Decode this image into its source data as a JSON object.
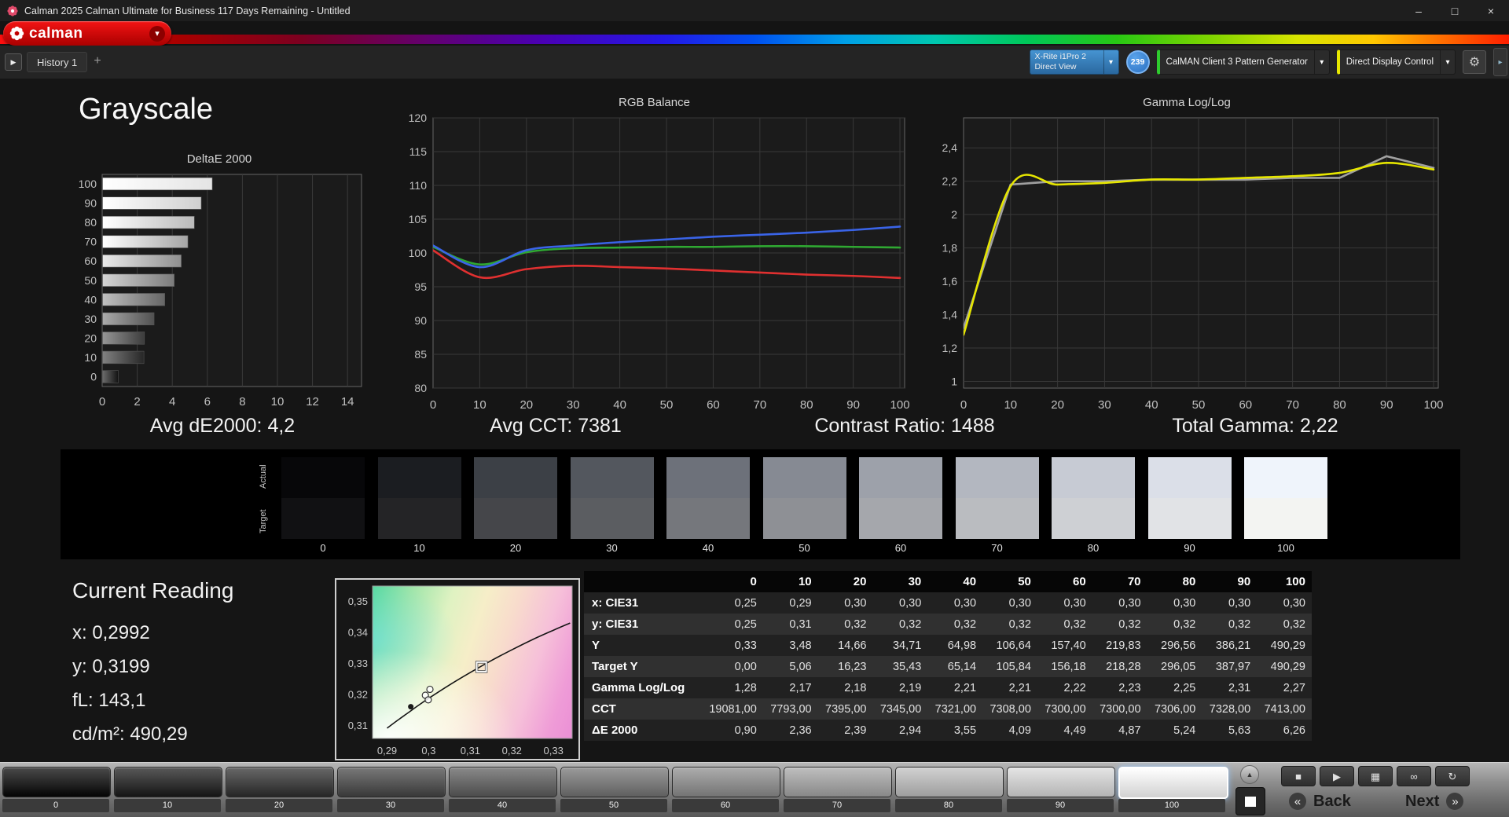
{
  "window": {
    "title": "Calman 2025 Calman Ultimate for Business 117 Days Remaining  - Untitled",
    "minimize": "–",
    "maximize": "□",
    "close": "×"
  },
  "brand": {
    "name": "calman"
  },
  "toolbar": {
    "collapse_glyph": "▶",
    "history_tab": "History 1",
    "add_tab": "+",
    "meter_line1": "X-Rite i1Pro 2",
    "meter_line2": "Direct View",
    "meter_badge": "239",
    "pattern_generator": "CalMAN Client 3 Pattern Generator",
    "display_control": "Direct Display Control",
    "dropdown_arrow": "▾",
    "gear_glyph": "⚙",
    "side_handle_glyph": "▸"
  },
  "page": {
    "title": "Grayscale"
  },
  "stats": [
    "Avg dE2000: 4,2",
    "Avg CCT: 7381",
    "Contrast Ratio: 1488",
    "Total Gamma: 2,22"
  ],
  "current_reading": {
    "title": "Current Reading",
    "lines": [
      "x: 0,2992",
      "y: 0,3199",
      "fL: 143,1",
      "cd/m²: 490,29"
    ]
  },
  "swatches": {
    "actual_label": "Actual",
    "target_label": "Target",
    "items": [
      {
        "label": "0",
        "actual": "#070709",
        "target": "#111113"
      },
      {
        "label": "10",
        "actual": "#1b1d21",
        "target": "#242426"
      },
      {
        "label": "20",
        "actual": "#3c4046",
        "target": "#45464a"
      },
      {
        "label": "30",
        "actual": "#53575e",
        "target": "#5b5d61"
      },
      {
        "label": "40",
        "actual": "#6d717a",
        "target": "#75777c"
      },
      {
        "label": "50",
        "actual": "#868a93",
        "target": "#8e9095"
      },
      {
        "label": "60",
        "actual": "#9da1aa",
        "target": "#a5a7ac"
      },
      {
        "label": "70",
        "actual": "#b3b7c0",
        "target": "#babcc0"
      },
      {
        "label": "80",
        "actual": "#c7cbd4",
        "target": "#ced0d4"
      },
      {
        "label": "90",
        "actual": "#dbdfe8",
        "target": "#e1e3e6"
      },
      {
        "label": "100",
        "actual": "#eff4fb",
        "target": "#f3f4f2"
      }
    ]
  },
  "table": {
    "columns": [
      "0",
      "10",
      "20",
      "30",
      "40",
      "50",
      "60",
      "70",
      "80",
      "90",
      "100"
    ],
    "rows": [
      {
        "label": "x: CIE31",
        "values": [
          "0,25",
          "0,29",
          "0,30",
          "0,30",
          "0,30",
          "0,30",
          "0,30",
          "0,30",
          "0,30",
          "0,30",
          "0,30"
        ]
      },
      {
        "label": "y: CIE31",
        "values": [
          "0,25",
          "0,31",
          "0,32",
          "0,32",
          "0,32",
          "0,32",
          "0,32",
          "0,32",
          "0,32",
          "0,32",
          "0,32"
        ]
      },
      {
        "label": "Y",
        "values": [
          "0,33",
          "3,48",
          "14,66",
          "34,71",
          "64,98",
          "106,64",
          "157,40",
          "219,83",
          "296,56",
          "386,21",
          "490,29"
        ]
      },
      {
        "label": "Target Y",
        "values": [
          "0,00",
          "5,06",
          "16,23",
          "35,43",
          "65,14",
          "105,84",
          "156,18",
          "218,28",
          "296,05",
          "387,97",
          "490,29"
        ]
      },
      {
        "label": "Gamma Log/Log",
        "values": [
          "1,28",
          "2,17",
          "2,18",
          "2,19",
          "2,21",
          "2,21",
          "2,22",
          "2,23",
          "2,25",
          "2,31",
          "2,27"
        ]
      },
      {
        "label": "CCT",
        "values": [
          "19081,00",
          "7793,00",
          "7395,00",
          "7345,00",
          "7321,00",
          "7308,00",
          "7300,00",
          "7300,00",
          "7306,00",
          "7328,00",
          "7413,00"
        ]
      },
      {
        "label": "ΔE 2000",
        "values": [
          "0,90",
          "2,36",
          "2,39",
          "2,94",
          "3,55",
          "4,09",
          "4,49",
          "4,87",
          "5,24",
          "5,63",
          "6,26"
        ]
      }
    ]
  },
  "chart_data": [
    {
      "id": "deltae2000",
      "type": "bar",
      "orientation": "horizontal",
      "title": "DeltaE 2000",
      "categories": [
        100,
        90,
        80,
        70,
        60,
        50,
        40,
        30,
        20,
        10,
        0
      ],
      "values": [
        6.26,
        5.63,
        5.24,
        4.87,
        4.49,
        4.09,
        3.55,
        2.94,
        2.39,
        2.36,
        0.9
      ],
      "xlim": [
        0,
        14.8
      ],
      "xticks": [
        0,
        2,
        4,
        6,
        8,
        10,
        12,
        14
      ],
      "grid": true,
      "legend": "none"
    },
    {
      "id": "rgb-balance",
      "type": "line",
      "title": "RGB Balance",
      "x": [
        0,
        10,
        20,
        30,
        40,
        50,
        60,
        70,
        80,
        90,
        100
      ],
      "series": [
        {
          "name": "Red",
          "color": "#e03030",
          "smooth": true,
          "values": [
            100.4,
            96.4,
            97.6,
            98.1,
            97.9,
            97.7,
            97.4,
            97.1,
            96.8,
            96.6,
            96.3
          ]
        },
        {
          "name": "Green",
          "color": "#2fa832",
          "smooth": true,
          "values": [
            100.9,
            98.3,
            100.1,
            100.7,
            100.8,
            100.9,
            100.9,
            101.0,
            101.0,
            100.9,
            100.8
          ]
        },
        {
          "name": "Blue",
          "color": "#3a64e8",
          "smooth": true,
          "values": [
            101.1,
            97.9,
            100.4,
            101.1,
            101.6,
            102.0,
            102.4,
            102.7,
            103.0,
            103.4,
            103.9
          ]
        }
      ],
      "xlim": [
        0,
        101
      ],
      "ylim": [
        80,
        120
      ],
      "xticks": [
        0,
        10,
        20,
        30,
        40,
        50,
        60,
        70,
        80,
        90,
        100
      ],
      "yticks": [
        80,
        85,
        90,
        95,
        100,
        105,
        110,
        115,
        120
      ],
      "grid": true,
      "legend": "none"
    },
    {
      "id": "gamma-loglog",
      "type": "line",
      "title": "Gamma Log/Log",
      "x": [
        0,
        10,
        20,
        30,
        40,
        50,
        60,
        70,
        80,
        90,
        100
      ],
      "series": [
        {
          "name": "Reference",
          "color": "#a0a0a0",
          "smooth": false,
          "values": [
            1.32,
            2.18,
            2.2,
            2.2,
            2.21,
            2.21,
            2.21,
            2.22,
            2.22,
            2.35,
            2.28
          ]
        },
        {
          "name": "Measured",
          "color": "#e6e600",
          "smooth": true,
          "values": [
            1.28,
            2.17,
            2.18,
            2.19,
            2.21,
            2.21,
            2.22,
            2.23,
            2.25,
            2.31,
            2.27
          ]
        }
      ],
      "xlim": [
        0,
        101
      ],
      "ylim": [
        0.96,
        2.58
      ],
      "xticks": [
        0,
        10,
        20,
        30,
        40,
        50,
        60,
        70,
        80,
        90,
        100
      ],
      "yticks": [
        1,
        1.2,
        1.4,
        1.6,
        1.8,
        2,
        2.2,
        2.4
      ],
      "ytick_labels": [
        "1",
        "1,2",
        "1,4",
        "1,6",
        "1,8",
        "2",
        "2,2",
        "2,4"
      ],
      "grid": true,
      "legend": "none"
    },
    {
      "id": "cie-chromaticity",
      "type": "scatter",
      "title": "",
      "xlim": [
        0.2865,
        0.3345
      ],
      "ylim": [
        0.306,
        0.355
      ],
      "xticks": [
        0.29,
        0.3,
        0.31,
        0.32,
        0.33
      ],
      "xtick_labels": [
        "0,29",
        "0,3",
        "0,31",
        "0,32",
        "0,33"
      ],
      "yticks": [
        0.31,
        0.32,
        0.33,
        0.34,
        0.35
      ],
      "ytick_labels": [
        "0,31",
        "0,32",
        "0,33",
        "0,34",
        "0,35"
      ],
      "locus": [
        [
          0.29,
          0.3093
        ],
        [
          0.2925,
          0.3118
        ],
        [
          0.295,
          0.3142
        ],
        [
          0.2975,
          0.3166
        ],
        [
          0.3,
          0.3189
        ],
        [
          0.305,
          0.3232
        ],
        [
          0.31,
          0.3272
        ],
        [
          0.315,
          0.331
        ],
        [
          0.32,
          0.3345
        ],
        [
          0.325,
          0.3378
        ],
        [
          0.33,
          0.3408
        ],
        [
          0.334,
          0.3431
        ]
      ],
      "target_point": [
        0.3127,
        0.329
      ],
      "measured_points": [
        [
          0.2992,
          0.3199
        ],
        [
          0.3003,
          0.3218
        ],
        [
          0.2999,
          0.3184
        ]
      ],
      "filled_point": [
        0.2957,
        0.3162
      ]
    }
  ],
  "bottom": {
    "patches": [
      {
        "label": "0",
        "color": "#050505"
      },
      {
        "label": "10",
        "color": "#191919"
      },
      {
        "label": "20",
        "color": "#2e2e2e"
      },
      {
        "label": "30",
        "color": "#454545"
      },
      {
        "label": "40",
        "color": "#5c5c5c"
      },
      {
        "label": "50",
        "color": "#747474"
      },
      {
        "label": "60",
        "color": "#8d8d8d"
      },
      {
        "label": "70",
        "color": "#a6a6a6"
      },
      {
        "label": "80",
        "color": "#c0c0c0"
      },
      {
        "label": "90",
        "color": "#dbdbdb"
      },
      {
        "label": "100",
        "color": "#ffffff",
        "selected": true
      }
    ],
    "transport": [
      {
        "name": "stop",
        "glyph": "■"
      },
      {
        "name": "play",
        "glyph": "▶"
      },
      {
        "name": "save",
        "glyph": "▦"
      },
      {
        "name": "link",
        "glyph": "∞"
      },
      {
        "name": "refresh",
        "glyph": "↻"
      }
    ],
    "up_glyph": "▲",
    "back_chevron": "«",
    "back_label": "Back",
    "next_label": "Next",
    "next_chevron": "»"
  },
  "colors": {
    "accent_red": "#e03030",
    "accent_green": "#2fa832",
    "accent_blue": "#3a64e8",
    "accent_yellow": "#e6e600",
    "meter_blue": "#3a86c6",
    "pg_green": "#2ecc2e",
    "ddc_yellow": "#e8e800"
  }
}
